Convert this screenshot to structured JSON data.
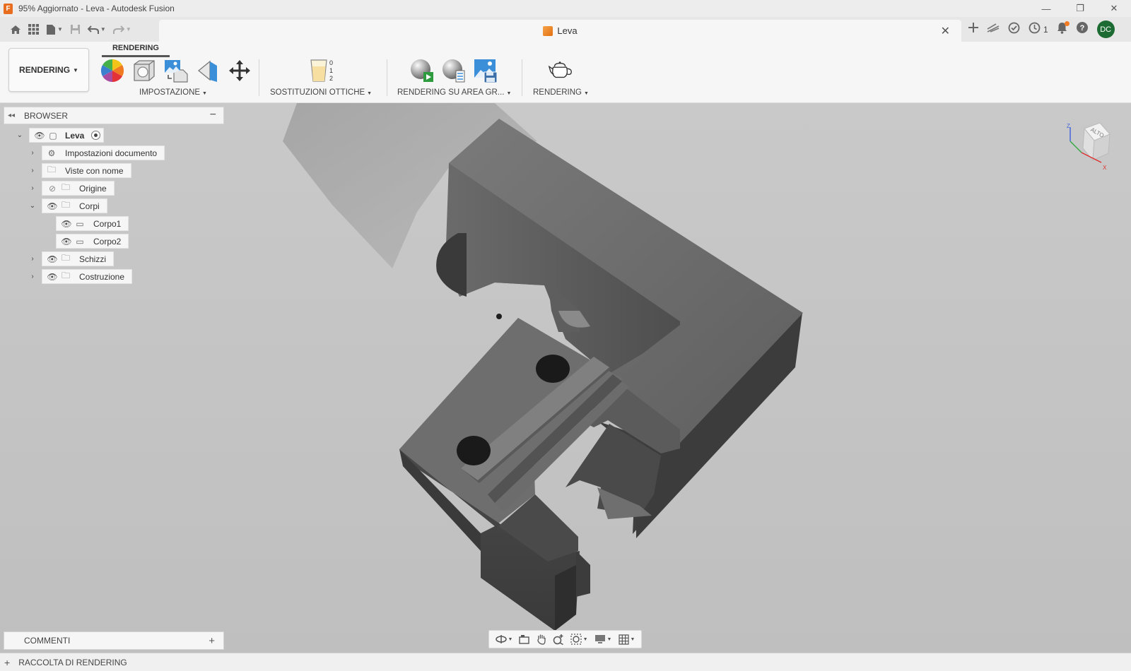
{
  "window": {
    "title": "95% Aggiornato - Leva - Autodesk Fusion",
    "app_icon_letter": "F",
    "controls": [
      "—",
      "❐",
      "✕"
    ]
  },
  "document_tab": {
    "name": "Leva",
    "close": "✕"
  },
  "header_right": {
    "job_count": "1",
    "user_initials": "DC"
  },
  "toolbar": {
    "workspace_label": "RENDERING",
    "active_tab": "RENDERING",
    "groups": {
      "setup": "IMPOSTAZIONE",
      "overrides": "SOSTITUZIONI OTTICHE",
      "incanvas": "RENDERING SU AREA GR...",
      "render": "RENDERING"
    },
    "override_digits": [
      "0",
      "1",
      "2"
    ]
  },
  "browser": {
    "title": "BROWSER",
    "root": {
      "label": "Leva"
    },
    "items": [
      {
        "label": "Impostazioni documento",
        "icon": "gear-icon"
      },
      {
        "label": "Viste con nome",
        "icon": "folder-icon"
      },
      {
        "label": "Origine",
        "icon": "folder-icon",
        "visible": false
      },
      {
        "label": "Corpi",
        "icon": "folder-icon",
        "visible": true,
        "expanded": true
      },
      {
        "label": "Corpo1",
        "icon": "body-icon",
        "visible": true
      },
      {
        "label": "Corpo2",
        "icon": "body-icon",
        "visible": true
      },
      {
        "label": "Schizzi",
        "icon": "folder-icon",
        "visible": true
      },
      {
        "label": "Costruzione",
        "icon": "folder-icon",
        "visible": true
      }
    ]
  },
  "viewcube": {
    "face": "ALTO",
    "axis_z": "Z",
    "axis_x": "X"
  },
  "comments": {
    "label": "COMMENTI"
  },
  "bottom": {
    "label": "RACCOLTA DI RENDERING"
  },
  "colors": {
    "accent_orange": "#e96d1f",
    "avatar_green": "#1c6b32",
    "viewport_bg": "#c4c4c4"
  }
}
